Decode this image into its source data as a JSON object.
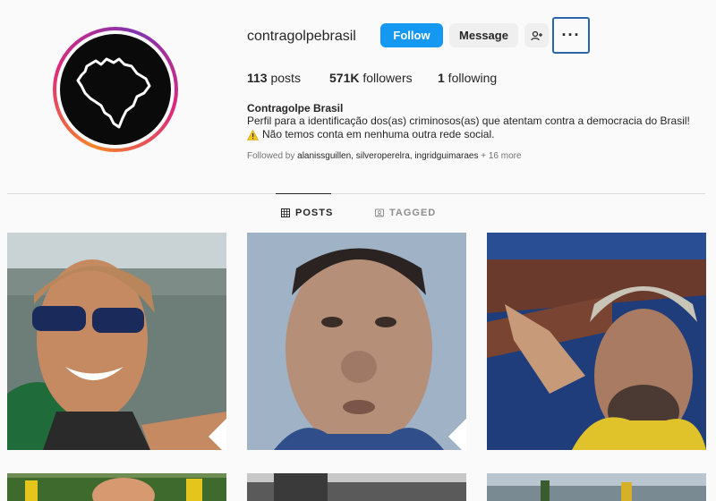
{
  "profile": {
    "username": "contragolpebrasil",
    "full_name": "Contragolpe Brasil",
    "bio_line1": "Perfil para a identificação dos(as) criminosos(as) que atentam contra a democracia do Brasil!",
    "bio_line2": "Não temos conta em nenhuma outra rede social.",
    "followed_by_prefix": "Followed by ",
    "followed_by_names": "alanissguillen, silveroperelra, ingridguimaraes",
    "followed_by_more": " + 16 more"
  },
  "actions": {
    "follow": "Follow",
    "message": "Message",
    "suggest_icon": "person-add-icon",
    "more": "···"
  },
  "stats": {
    "posts_count": "113",
    "posts_label": " posts",
    "followers_count": "571K",
    "followers_label": " followers",
    "following_count": "1",
    "following_label": " following"
  },
  "tabs": {
    "posts": "POSTS",
    "tagged": "TAGGED"
  },
  "colors": {
    "follow_bg": "#1498f2",
    "accent_ring_start": "#f58529",
    "accent_ring_mid": "#dd2a7b"
  },
  "posts": [
    {
      "pinned": true,
      "icon": "pin-icon"
    },
    {
      "pinned": true,
      "icon": "pin-icon"
    },
    {
      "pinned": false
    },
    {
      "pinned": false
    },
    {
      "pinned": false
    },
    {
      "pinned": false
    }
  ]
}
